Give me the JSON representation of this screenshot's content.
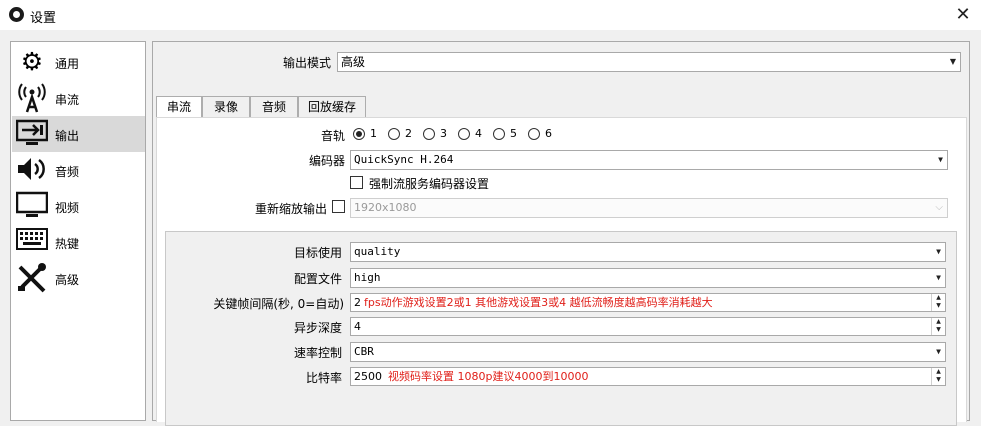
{
  "window": {
    "title": "设置",
    "close_glyph": "✕"
  },
  "sidebar": {
    "items": [
      {
        "label": "通用",
        "icon": "gear-icon",
        "glyph": "⚙"
      },
      {
        "label": "串流",
        "icon": "broadcast-icon",
        "glyph": "📡"
      },
      {
        "label": "输出",
        "icon": "output-icon",
        "glyph": "⇥"
      },
      {
        "label": "音频",
        "icon": "speaker-icon",
        "glyph": "🔊"
      },
      {
        "label": "视频",
        "icon": "monitor-icon",
        "glyph": "🖥"
      },
      {
        "label": "热键",
        "icon": "keyboard-icon",
        "glyph": "⌨"
      },
      {
        "label": "高级",
        "icon": "tools-icon",
        "glyph": "✂"
      }
    ],
    "selected": "输出"
  },
  "output_mode": {
    "label": "输出模式",
    "value": "高级"
  },
  "tabs": [
    {
      "label": "串流",
      "active": true
    },
    {
      "label": "录像"
    },
    {
      "label": "音频"
    },
    {
      "label": "回放缓存"
    }
  ],
  "stream": {
    "audio_track": {
      "label": "音轨",
      "options": [
        "1",
        "2",
        "3",
        "4",
        "5",
        "6"
      ],
      "selected": "1"
    },
    "encoder": {
      "label": "编码器",
      "value": "QuickSync H.264"
    },
    "enforce": {
      "label": "强制流服务编码器设置",
      "checked": false
    },
    "rescale": {
      "label": "重新缩放输出",
      "checked": false,
      "value": "1920x1080"
    }
  },
  "encoder_settings": {
    "target_usage": {
      "label": "目标使用",
      "value": "quality"
    },
    "profile": {
      "label": "配置文件",
      "value": "high"
    },
    "keyframe": {
      "label": "关键帧间隔(秒, 0=自动)",
      "value": "2",
      "note": "fps动作游戏设置2或1 其他游戏设置3或4  越低流畅度越高码率消耗越大"
    },
    "async_depth": {
      "label": "异步深度",
      "value": "4"
    },
    "rate_control": {
      "label": "速率控制",
      "value": "CBR"
    },
    "bitrate": {
      "label": "比特率",
      "value": "2500",
      "note": "视频码率设置 1080p建议4000到10000"
    }
  },
  "glyphs": {
    "combo_arrow": "▼",
    "disabled_arrow": "⌵",
    "spin_up": "▲",
    "spin_down": "▼"
  }
}
